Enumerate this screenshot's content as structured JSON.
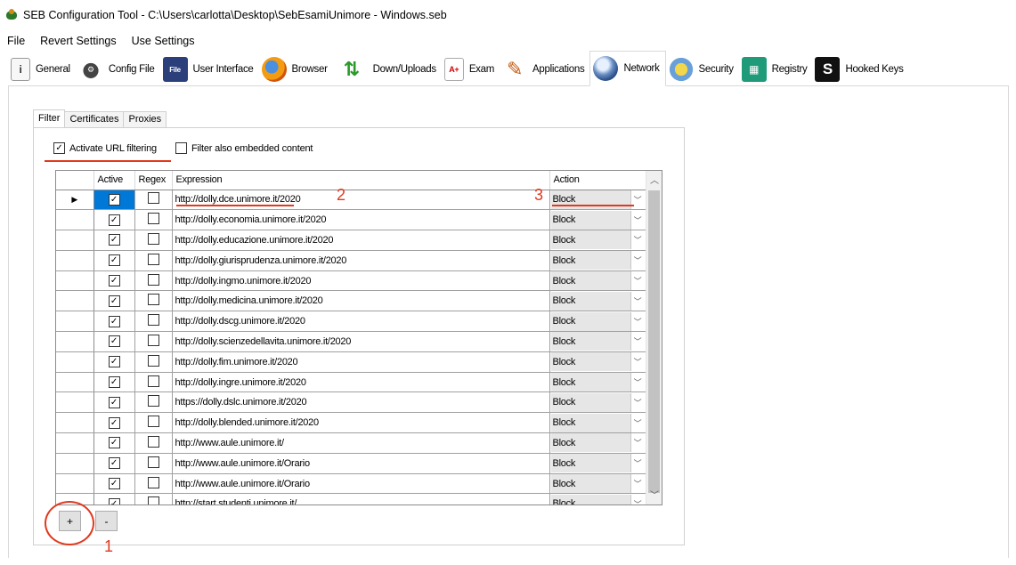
{
  "window": {
    "title": "SEB Configuration Tool - C:\\Users\\carlotta\\Desktop\\SebEsamiUnimore - Windows.seb"
  },
  "menu": [
    "File",
    "Revert Settings",
    "Use Settings"
  ],
  "tabs": [
    {
      "label": "General",
      "icon": "general-icon",
      "glyph": "i"
    },
    {
      "label": "Config File",
      "icon": "config-file-icon",
      "glyph": "⚙"
    },
    {
      "label": "User Interface",
      "icon": "user-interface-icon",
      "glyph": "File"
    },
    {
      "label": "Browser",
      "icon": "browser-icon",
      "glyph": ""
    },
    {
      "label": "Down/Uploads",
      "icon": "down-uploads-icon",
      "glyph": "⇅"
    },
    {
      "label": "Exam",
      "icon": "exam-icon",
      "glyph": "A+"
    },
    {
      "label": "Applications",
      "icon": "applications-icon",
      "glyph": "✎"
    },
    {
      "label": "Network",
      "icon": "network-icon",
      "glyph": ""
    },
    {
      "label": "Security",
      "icon": "security-icon",
      "glyph": ""
    },
    {
      "label": "Registry",
      "icon": "registry-icon",
      "glyph": "▦"
    },
    {
      "label": "Hooked Keys",
      "icon": "hooked-keys-icon",
      "glyph": "S"
    }
  ],
  "active_tab": "Network",
  "subtabs": [
    "Filter",
    "Certificates",
    "Proxies"
  ],
  "active_subtab": "Filter",
  "filter": {
    "activate_url_filtering": {
      "label": "Activate URL filtering",
      "checked": true
    },
    "filter_embedded": {
      "label": "Filter also embedded content",
      "checked": false
    }
  },
  "grid": {
    "headers": {
      "active": "Active",
      "regex": "Regex",
      "expression": "Expression",
      "action": "Action"
    },
    "rows": [
      {
        "active": true,
        "regex": false,
        "expression": "http://dolly.dce.unimore.it/2020",
        "action": "Block"
      },
      {
        "active": true,
        "regex": false,
        "expression": "http://dolly.economia.unimore.it/2020",
        "action": "Block"
      },
      {
        "active": true,
        "regex": false,
        "expression": "http://dolly.educazione.unimore.it/2020",
        "action": "Block"
      },
      {
        "active": true,
        "regex": false,
        "expression": "http://dolly.giurisprudenza.unimore.it/2020",
        "action": "Block"
      },
      {
        "active": true,
        "regex": false,
        "expression": "http://dolly.ingmo.unimore.it/2020",
        "action": "Block"
      },
      {
        "active": true,
        "regex": false,
        "expression": "http://dolly.medicina.unimore.it/2020",
        "action": "Block"
      },
      {
        "active": true,
        "regex": false,
        "expression": "http://dolly.dscg.unimore.it/2020",
        "action": "Block"
      },
      {
        "active": true,
        "regex": false,
        "expression": "http://dolly.scienzedellavita.unimore.it/2020",
        "action": "Block"
      },
      {
        "active": true,
        "regex": false,
        "expression": "http://dolly.fim.unimore.it/2020",
        "action": "Block"
      },
      {
        "active": true,
        "regex": false,
        "expression": "http://dolly.ingre.unimore.it/2020",
        "action": "Block"
      },
      {
        "active": true,
        "regex": false,
        "expression": "https://dolly.dslc.unimore.it/2020",
        "action": "Block"
      },
      {
        "active": true,
        "regex": false,
        "expression": "http://dolly.blended.unimore.it/2020",
        "action": "Block"
      },
      {
        "active": true,
        "regex": false,
        "expression": "http://www.aule.unimore.it/",
        "action": "Block"
      },
      {
        "active": true,
        "regex": false,
        "expression": "http://www.aule.unimore.it/Orario",
        "action": "Block"
      },
      {
        "active": true,
        "regex": false,
        "expression": "http://www.aule.unimore.it/Orario",
        "action": "Block"
      },
      {
        "active": true,
        "regex": false,
        "expression": "http://start.studenti.unimore.it/",
        "action": "Block"
      }
    ]
  },
  "buttons": {
    "add": "+",
    "remove": "-"
  },
  "annotations": {
    "one": "1",
    "two": "2",
    "three": "3"
  },
  "colors": {
    "annotation": "#e0391f",
    "selection": "#0078d7"
  }
}
